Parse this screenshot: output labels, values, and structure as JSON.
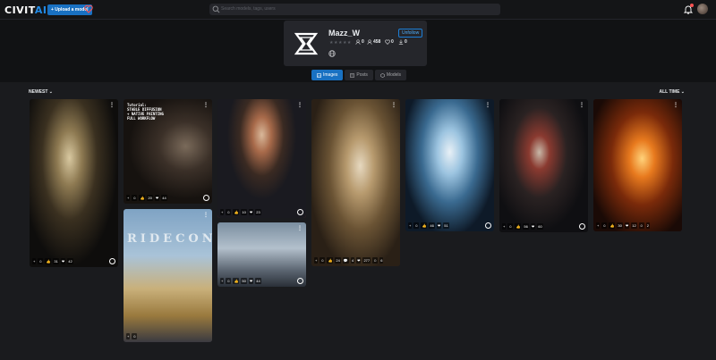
{
  "nav": {
    "logo_main": "CIVIT",
    "logo_ai": "AI",
    "upload_label": "+ Upload a model",
    "search_placeholder": "Search models, tags, users"
  },
  "profile": {
    "username": "Mazz_W",
    "unfollow_label": "Unfollow",
    "stars": "★★★★★",
    "rating_count": "0",
    "followers": "458",
    "favorites": "0",
    "downloads": "0"
  },
  "tabs": [
    {
      "label": "Images",
      "active": true,
      "icon": "image-icon"
    },
    {
      "label": "Posts",
      "active": false,
      "icon": "post-icon"
    },
    {
      "label": "Models",
      "active": false,
      "icon": "model-icon"
    }
  ],
  "sort": {
    "label": "NEWEST ⌄"
  },
  "period": {
    "label": "ALL TIME ⌄"
  },
  "cards": [
    {
      "reactions": [
        "+",
        "☺",
        "👍",
        "31",
        "❤",
        "42"
      ]
    },
    {
      "overlay": "Tutorial:\nSTABLE DIFFUSION\n+ NATIVE PAINTING\nFULL WORKFLOW",
      "reactions": [
        "+",
        "☺",
        "👍",
        "20",
        "❤",
        "44"
      ]
    },
    {
      "reactions": [
        "+",
        "☺",
        "👍",
        "10",
        "❤",
        "23"
      ]
    },
    {
      "reactions": [
        "+",
        "☺",
        "👍",
        "24",
        "💬",
        "4",
        "❤",
        "277",
        "☺",
        "6"
      ]
    },
    {
      "reactions": [
        "+",
        "☺",
        "👍",
        "46",
        "❤",
        "51"
      ]
    },
    {
      "reactions": [
        "+",
        "☺",
        "👍",
        "56",
        "❤",
        "60"
      ]
    },
    {
      "reactions": [
        "+",
        "☺",
        "👍",
        "30",
        "❤",
        "12",
        "☺",
        "2"
      ]
    },
    {
      "overlay_title": "RIDECON",
      "reactions": [
        "+",
        "☺"
      ]
    },
    {
      "reactions": [
        "+",
        "☺",
        "👍",
        "50",
        "❤",
        "44"
      ]
    }
  ],
  "colors": {
    "accent": "#1971c2",
    "bg": "#1a1b1e",
    "card": "#25262b"
  }
}
